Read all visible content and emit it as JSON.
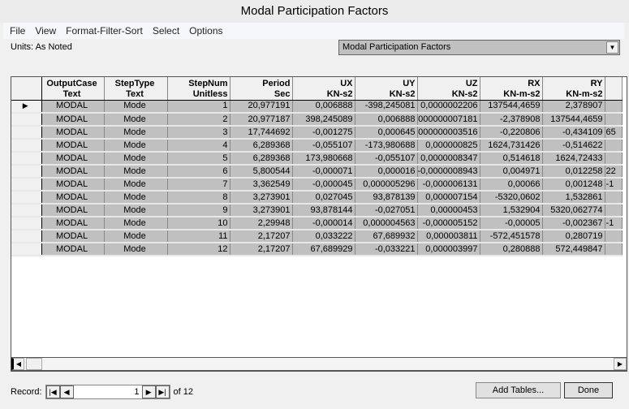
{
  "window": {
    "title": "Modal Participation Factors"
  },
  "menu": [
    "File",
    "View",
    "Format-Filter-Sort",
    "Select",
    "Options"
  ],
  "units_label": "Units:  As Noted",
  "table_select": {
    "value": "Modal Participation Factors"
  },
  "table": {
    "columns": [
      {
        "name": "OutputCase",
        "unit": "Text"
      },
      {
        "name": "StepType",
        "unit": "Text"
      },
      {
        "name": "StepNum",
        "unit": "Unitless"
      },
      {
        "name": "Period",
        "unit": "Sec"
      },
      {
        "name": "UX",
        "unit": "KN-s2"
      },
      {
        "name": "UY",
        "unit": "KN-s2"
      },
      {
        "name": "UZ",
        "unit": "KN-s2"
      },
      {
        "name": "RX",
        "unit": "KN-m-s2"
      },
      {
        "name": "RY",
        "unit": "KN-m-s2"
      },
      {
        "name": "",
        "unit": ""
      }
    ],
    "rows": [
      [
        "MODAL",
        "Mode",
        "1",
        "20,977191",
        "0,006888",
        "-398,245081",
        "0,0000002206",
        "137544,4659",
        "2,378907",
        ""
      ],
      [
        "MODAL",
        "Mode",
        "2",
        "20,977187",
        "398,245089",
        "0,006888",
        "000000007181",
        "-2,378908",
        "137544,4659",
        ""
      ],
      [
        "MODAL",
        "Mode",
        "3",
        "17,744692",
        "-0,001275",
        "0,000645",
        "000000003516",
        "-0,220806",
        "-0,434109",
        "65"
      ],
      [
        "MODAL",
        "Mode",
        "4",
        "6,289368",
        "-0,055107",
        "-173,980688",
        "0,000000825",
        "1624,731426",
        "-0,514622",
        ""
      ],
      [
        "MODAL",
        "Mode",
        "5",
        "6,289368",
        "173,980668",
        "-0,055107",
        "0,0000008347",
        "0,514618",
        "1624,72433",
        ""
      ],
      [
        "MODAL",
        "Mode",
        "6",
        "5,800544",
        "-0,000071",
        "0,000016",
        "-0,0000008943",
        "0,004971",
        "0,012258",
        "22"
      ],
      [
        "MODAL",
        "Mode",
        "7",
        "3,362549",
        "-0,000045",
        "0,000005296",
        "-0,000006131",
        "0,00066",
        "0,001248",
        "-1"
      ],
      [
        "MODAL",
        "Mode",
        "8",
        "3,273901",
        "0,027045",
        "93,878139",
        "0,000007154",
        "-5320,0602",
        "1,532861",
        ""
      ],
      [
        "MODAL",
        "Mode",
        "9",
        "3,273901",
        "93,878144",
        "-0,027051",
        "0,00000453",
        "1,532904",
        "5320,062774",
        ""
      ],
      [
        "MODAL",
        "Mode",
        "10",
        "2,29948",
        "-0,000014",
        "0,000004563",
        "-0,000005152",
        "-0,00005",
        "-0,002367",
        "-1"
      ],
      [
        "MODAL",
        "Mode",
        "11",
        "2,17207",
        "0,033222",
        "67,689932",
        "0,000003811",
        "-572,451578",
        "0,280719",
        ""
      ],
      [
        "MODAL",
        "Mode",
        "12",
        "2,17207",
        "67,689929",
        "-0,033221",
        "0,000003997",
        "0,280888",
        "572,449847",
        ""
      ]
    ],
    "current_row": 1
  },
  "record": {
    "label": "Record:",
    "current": "1",
    "of_label": "of 12"
  },
  "buttons": {
    "add_tables": "Add Tables...",
    "done": "Done"
  }
}
